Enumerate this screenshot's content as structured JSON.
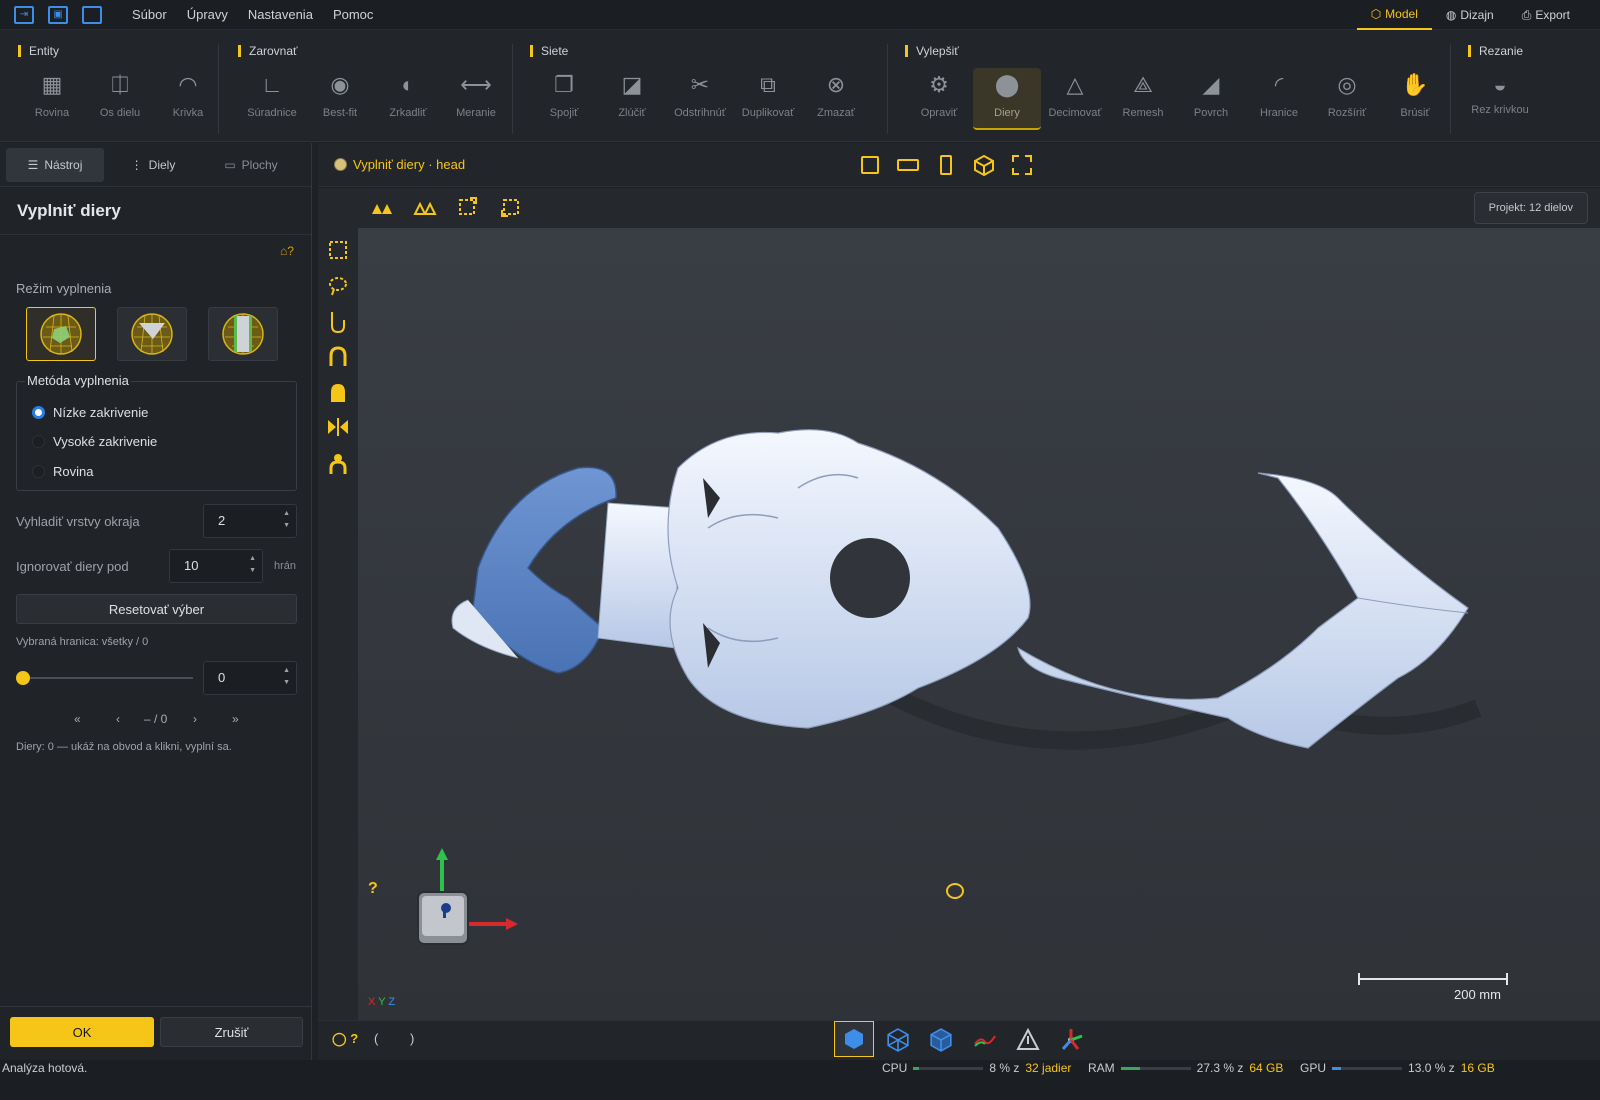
{
  "menubar": {
    "items": [
      "Súbor",
      "Úpravy",
      "Nastavenia",
      "Pomoc"
    ]
  },
  "modes": {
    "model": "Model",
    "dizajn": "Dizajn",
    "export": "Export"
  },
  "ribbon": {
    "groups": {
      "entity": {
        "title": "Entity",
        "tools": [
          "Rovina",
          "Os dielu",
          "Krivka"
        ]
      },
      "zarovnat": {
        "title": "Zarovnať",
        "tools": [
          "Súradnice",
          "Best-fit",
          "Zrkadliť",
          "Meranie"
        ]
      },
      "siete": {
        "title": "Siete",
        "tools": [
          "Spojiť",
          "Zlúčiť",
          "Odstrihnúť",
          "Duplikovať",
          "Zmazať"
        ]
      },
      "vylepsit": {
        "title": "Vylepšiť",
        "tools": [
          "Opraviť",
          "Diery",
          "Decimovať",
          "Remesh",
          "Povrch",
          "Hranice",
          "Rozšíriť",
          "Brúsiť"
        ]
      },
      "rezanie": {
        "title": "Rezanie",
        "tools": [
          "Rez krivkou"
        ]
      }
    }
  },
  "sidebar": {
    "tabs": [
      "Nástroj",
      "Diely",
      "Plochy"
    ],
    "title": "Vyplniť diery",
    "help": "?",
    "fill_mode_label": "Režim vyplnenia",
    "method_label": "Metóda vyplnenia",
    "methods": [
      "Nízke zakrivenie",
      "Vysoké zakrivenie",
      "Rovina"
    ],
    "selected_method": "Nízke zakrivenie",
    "smooth_label": "Vyhladiť vrstvy okraja",
    "smooth_value": "2",
    "ignore_label": "Ignorovať diery pod",
    "ignore_value": "10",
    "ignore_unit": "hrán",
    "reset_label": "Resetovať výber",
    "selected_border": "Vybraná hranica: všetky / 0",
    "slider_value": 0,
    "slider_field": "0",
    "nav": {
      "first": "«",
      "prev": "‹",
      "count": "– / 0",
      "next": "›",
      "last": "»"
    },
    "info": "Diery: 0 — ukáž na obvod a klikni, vyplní sa.",
    "ok": "OK",
    "cancel": "Zrušiť"
  },
  "viewport": {
    "title": "Vyplniť diery · head",
    "project_badge": "Projekt: 12 dielov",
    "help": "?",
    "axes_label": {
      "x": "X",
      "y": "Y",
      "z": "Z"
    },
    "scale": "200 mm",
    "bottom_left": {
      "help": "?",
      "lp": "(",
      "rp": ")"
    }
  },
  "status": {
    "text": "Analýza hotová.",
    "cpu_label": "CPU",
    "cpu_value": "8 % z",
    "cpu_total": "32 jadier",
    "cpu_fraction": 0.08,
    "ram_label": "RAM",
    "ram_value": "27.3 % z",
    "ram_total": "64 GB",
    "ram_fraction": 0.273,
    "gpu_label": "GPU",
    "gpu_value": "13.0 % z",
    "gpu_total": "16 GB",
    "gpu_fraction": 0.13
  },
  "colors": {
    "accent": "#f5c518",
    "model": "#c9d8ef",
    "part_blue": "#5b87c9",
    "select_blue": "#2a7de1"
  }
}
